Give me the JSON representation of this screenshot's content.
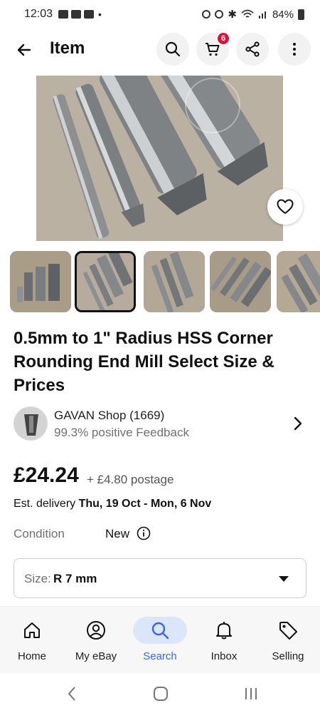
{
  "status_bar": {
    "time": "12:03",
    "dot": "•",
    "battery": "84%"
  },
  "header": {
    "title": "Item",
    "cart_count": "6"
  },
  "item": {
    "title": "0.5mm to 1\" Radius HSS Corner Rounding End Mill Select Size & Prices",
    "price": "£24.24",
    "postage": "+ £4.80 postage",
    "delivery_prefix": "Est. delivery",
    "delivery_dates": "Thu, 19 Oct - Mon, 6 Nov",
    "condition_label": "Condition",
    "condition_value": "New"
  },
  "seller": {
    "name": "GAVAN Shop (1669)",
    "feedback": "99.3% positive Feedback"
  },
  "size_select": {
    "label": "Size:",
    "value": "R 7 mm"
  },
  "nav": {
    "items": [
      {
        "label": "Home",
        "icon": "home-icon"
      },
      {
        "label": "My eBay",
        "icon": "account-icon"
      },
      {
        "label": "Search",
        "icon": "search-icon"
      },
      {
        "label": "Inbox",
        "icon": "bell-icon"
      },
      {
        "label": "Selling",
        "icon": "tag-icon"
      }
    ],
    "active": "Search"
  },
  "colors": {
    "accent": "#3665f3",
    "badge": "#e0103a",
    "active_pill": "#dbe6fb"
  }
}
